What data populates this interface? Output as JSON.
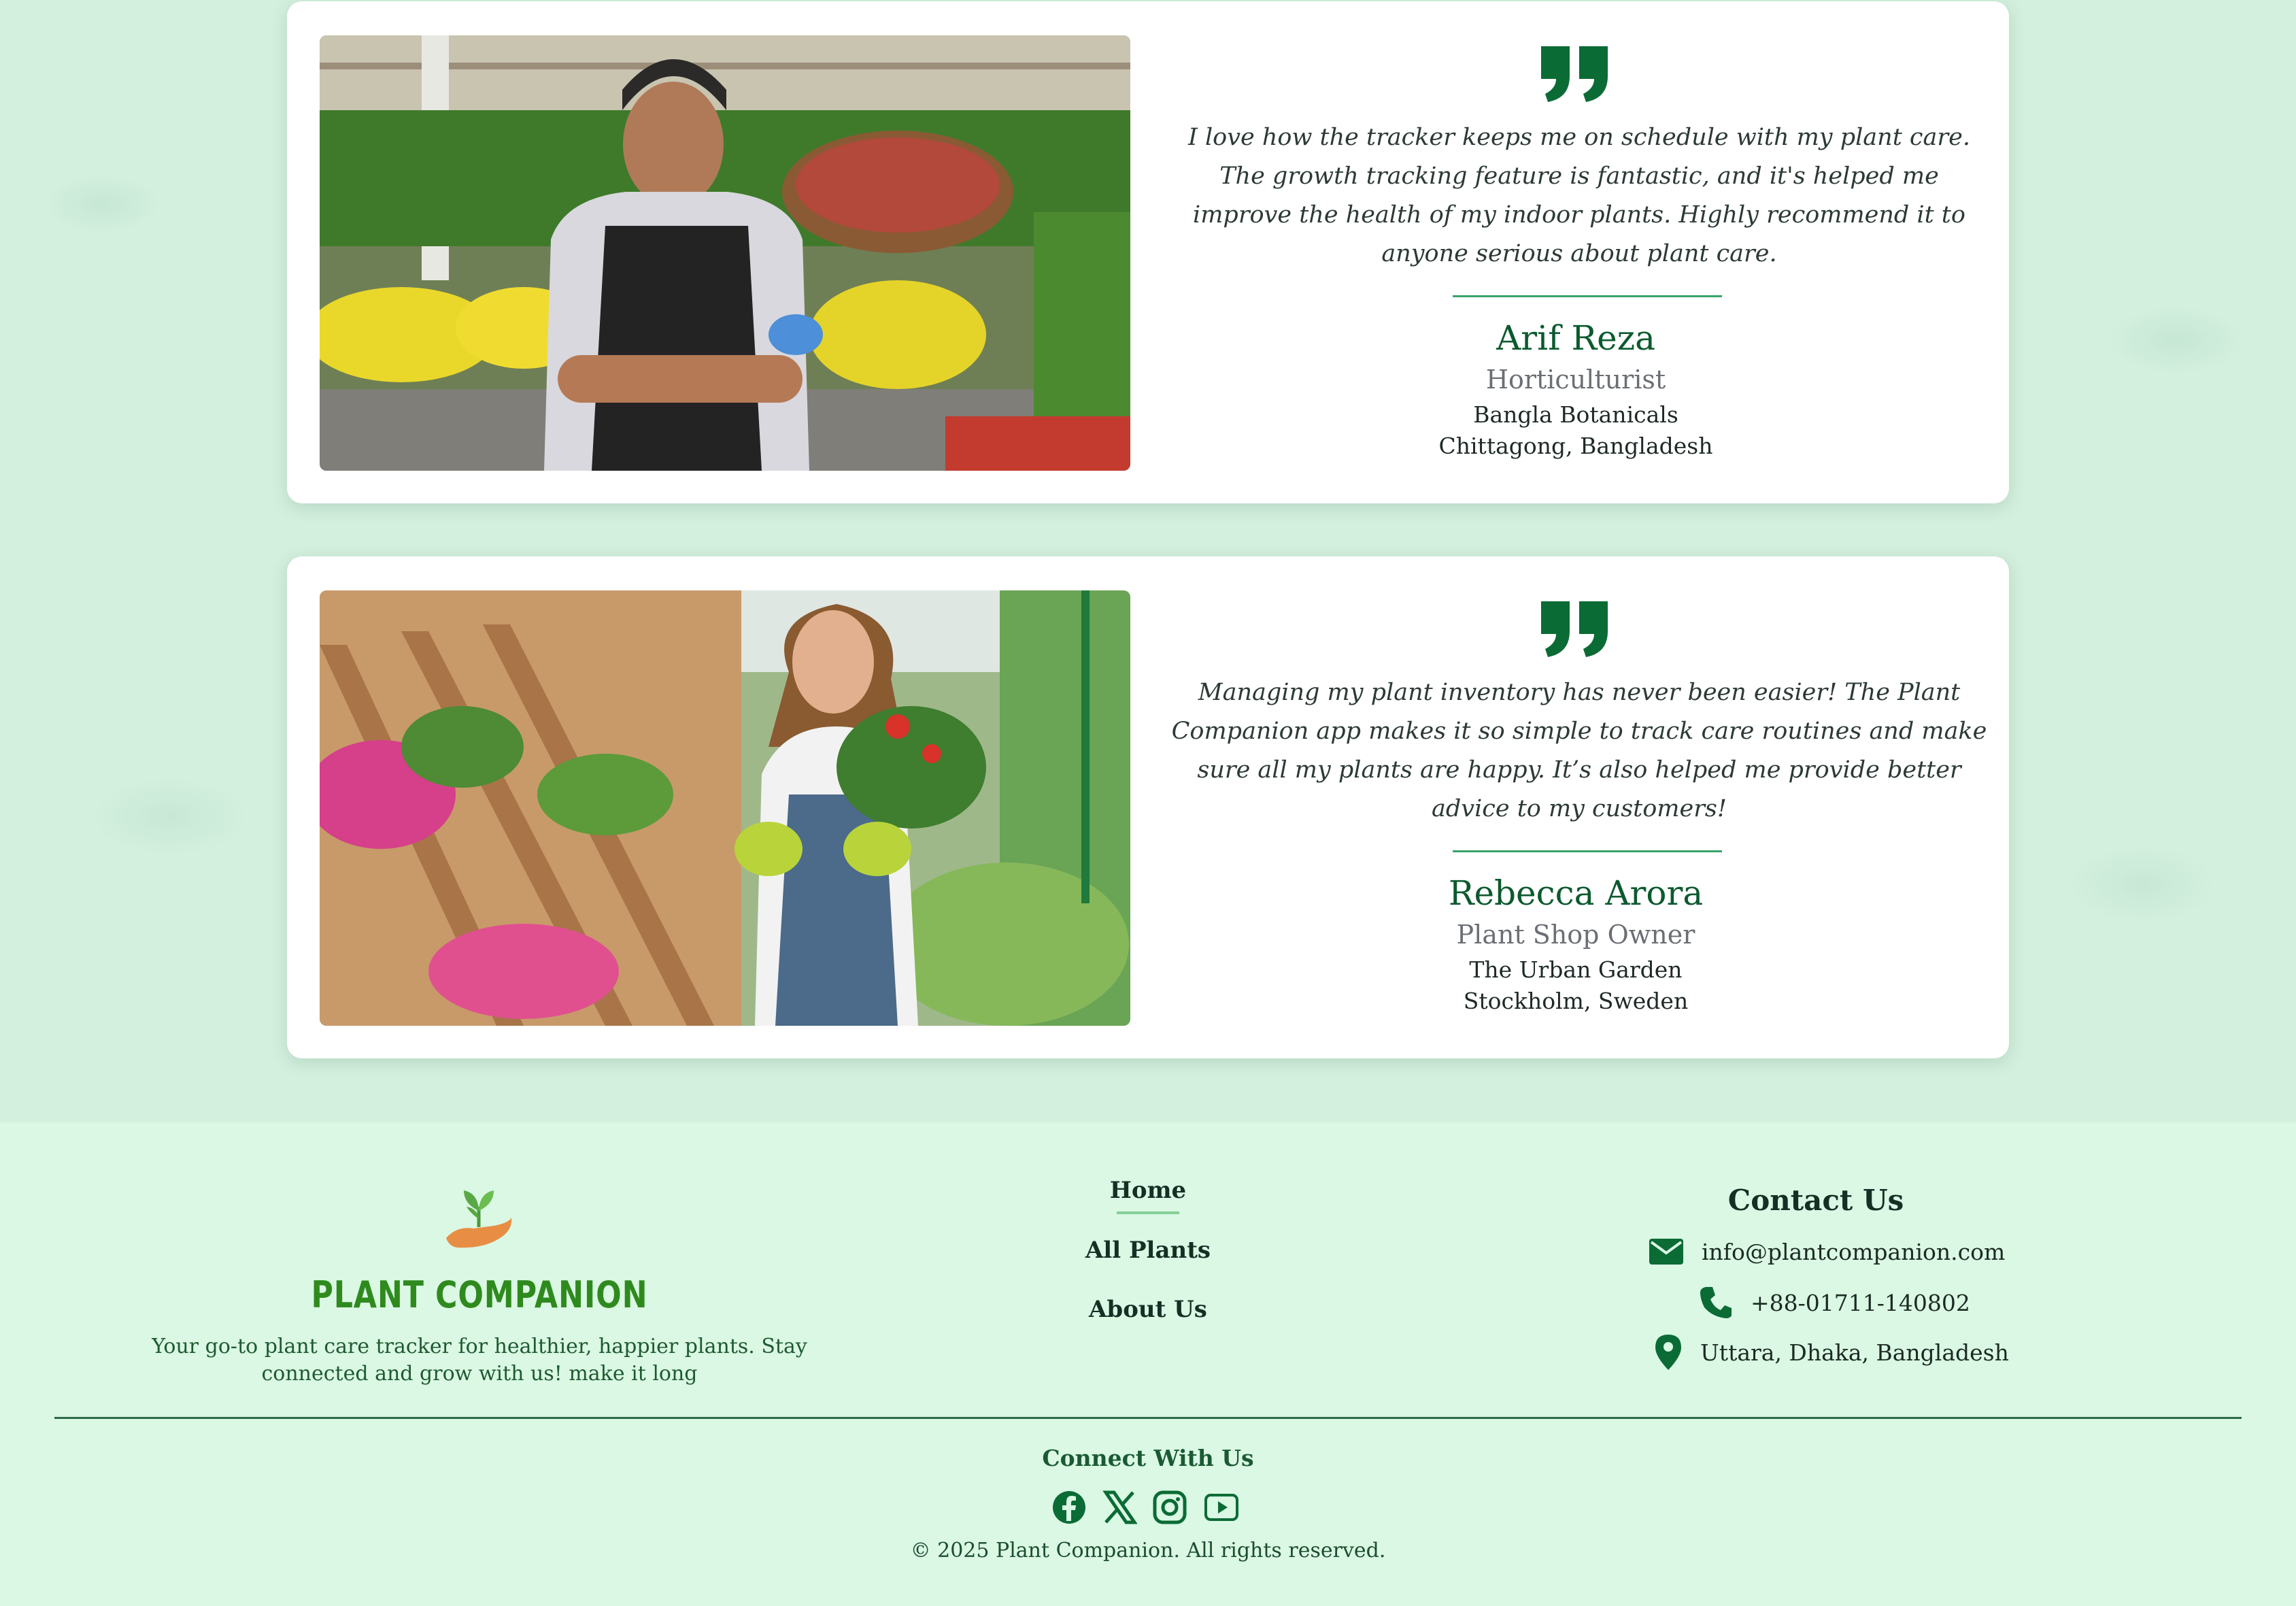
{
  "testimonials": [
    {
      "quote": "I love how the tracker keeps me on schedule with my plant care. The growth tracking feature is fantastic, and it's helped me improve the health of my indoor plants. Highly recommend it to anyone serious about plant care.",
      "name": "Arif Reza",
      "role": "Horticulturist",
      "organization": "Bangla Botanicals",
      "location": "Chittagong, Bangladesh",
      "photo": "man in apron at plant nursery"
    },
    {
      "quote": "Managing my plant inventory has never been easier! The Plant Companion app makes it so simple to track care routines and make sure all my plants are happy. It’s also helped me provide better advice to my customers!",
      "name": "Rebecca Arora",
      "role": "Plant Shop Owner",
      "organization": "The Urban Garden",
      "location": "Stockholm, Sweden",
      "photo": "woman holding potted plant in garden center"
    }
  ],
  "footer": {
    "brand": {
      "name": "PLANT COMPANION",
      "tagline": "Your go-to plant care tracker for healthier, happier plants. Stay connected and grow with us! make it long",
      "logo_icon": "hand-sprout-icon"
    },
    "nav": {
      "home": "Home",
      "all_plants": "All Plants",
      "about": "About Us"
    },
    "contact": {
      "title": "Contact Us",
      "email": "info@plantcompanion.com",
      "phone": "+88-01711-140802",
      "address": "Uttara, Dhaka, Bangladesh"
    },
    "connect_title": "Connect With Us",
    "social": [
      "facebook-icon",
      "x-icon",
      "instagram-icon",
      "youtube-icon"
    ],
    "copyright": "© 2025 Plant Companion. All rights reserved."
  },
  "colors": {
    "accent_green": "#0b6b35",
    "brand_green": "#2f8a1e",
    "background": "#d9f3e2"
  }
}
